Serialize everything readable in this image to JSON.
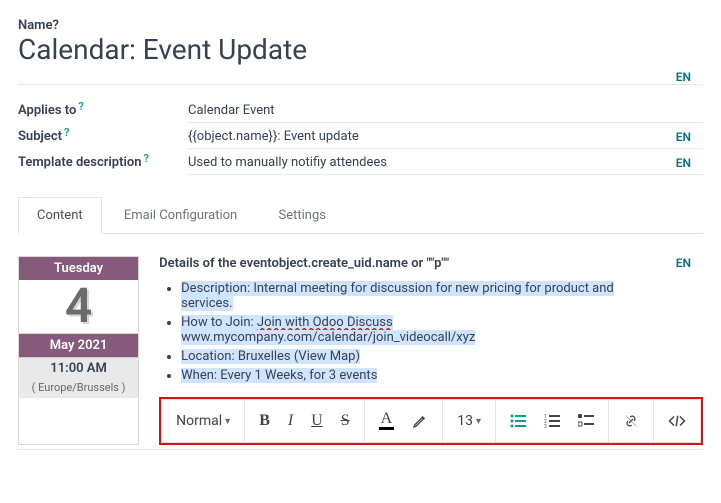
{
  "name": {
    "label": "Name",
    "value": "Calendar: Event Update",
    "en": "EN"
  },
  "applies_to": {
    "label": "Applies to",
    "value": "Calendar Event"
  },
  "subject": {
    "label": "Subject",
    "value": "{{object.name}}: Event update",
    "en": "EN"
  },
  "template_description": {
    "label": "Template description",
    "value": "Used to manually notifiy attendees",
    "en": "EN"
  },
  "tabs": {
    "content": "Content",
    "email_cfg": "Email Configuration",
    "settings": "Settings"
  },
  "cal": {
    "weekday": "Tuesday",
    "day": "4",
    "month": "May 2021",
    "time": "11:00 AM",
    "tz": "( Europe/Brussels )"
  },
  "content_heading": "Details of the eventobject.create_uid.name or \"\"p\"\"",
  "content_en": "EN",
  "bullets": {
    "b1a": "Description: Internal meeting for discussion for new pricing for product and",
    "b1b": "services.",
    "b2a": "How to Join: ",
    "b2b": "Join with Odoo Discuss",
    "b2c": "www.mycompany.com/calendar/join_videocall/xyz",
    "b3": "Location: Bruxelles (View Map)",
    "b4": "When: Every 1 Weeks, for 3 events"
  },
  "toolbar": {
    "normal": "Normal",
    "size": "13"
  }
}
